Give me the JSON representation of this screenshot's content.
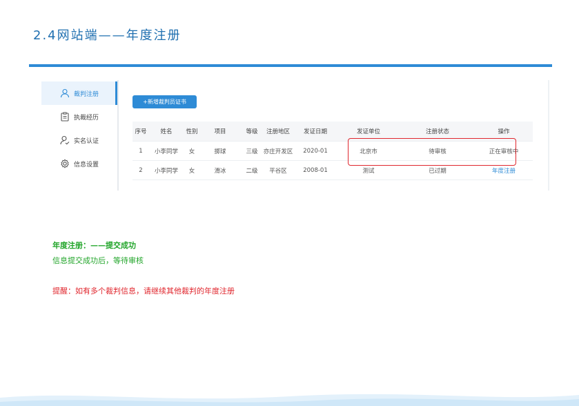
{
  "slide": {
    "title": "2.4网站端——年度注册"
  },
  "sidebar": {
    "items": [
      {
        "label": "裁判注册",
        "icon": "user-icon",
        "active": true
      },
      {
        "label": "执裁经历",
        "icon": "clipboard-icon",
        "active": false
      },
      {
        "label": "实名认证",
        "icon": "user-check-icon",
        "active": false
      },
      {
        "label": "信息设置",
        "icon": "gear-icon",
        "active": false
      }
    ]
  },
  "toolbar": {
    "add_label": "+新增裁判员证书"
  },
  "table": {
    "headers": [
      "序号",
      "姓名",
      "性别",
      "项目",
      "等级",
      "注册地区",
      "发证日期",
      "发证单位",
      "注册状态",
      "操作"
    ],
    "rows": [
      [
        "1",
        "小李同学",
        "女",
        "掷球",
        "三级",
        "亦庄开发区",
        "2020-01",
        "北京市",
        "待审核",
        "正在审核中"
      ],
      [
        "2",
        "小李同学",
        "女",
        "滑冰",
        "二级",
        "平谷区",
        "2008-01",
        "测试",
        "已过期",
        "年度注册"
      ]
    ]
  },
  "notes": {
    "title": "年度注册：——提交成功",
    "body": "信息提交成功后，等待审核",
    "reminder": "提醒：如有多个裁判信息，请继续其他裁判的年度注册"
  },
  "colors": {
    "accent": "#2e8bd6",
    "success": "#22a52a",
    "warning": "#e0262d"
  }
}
